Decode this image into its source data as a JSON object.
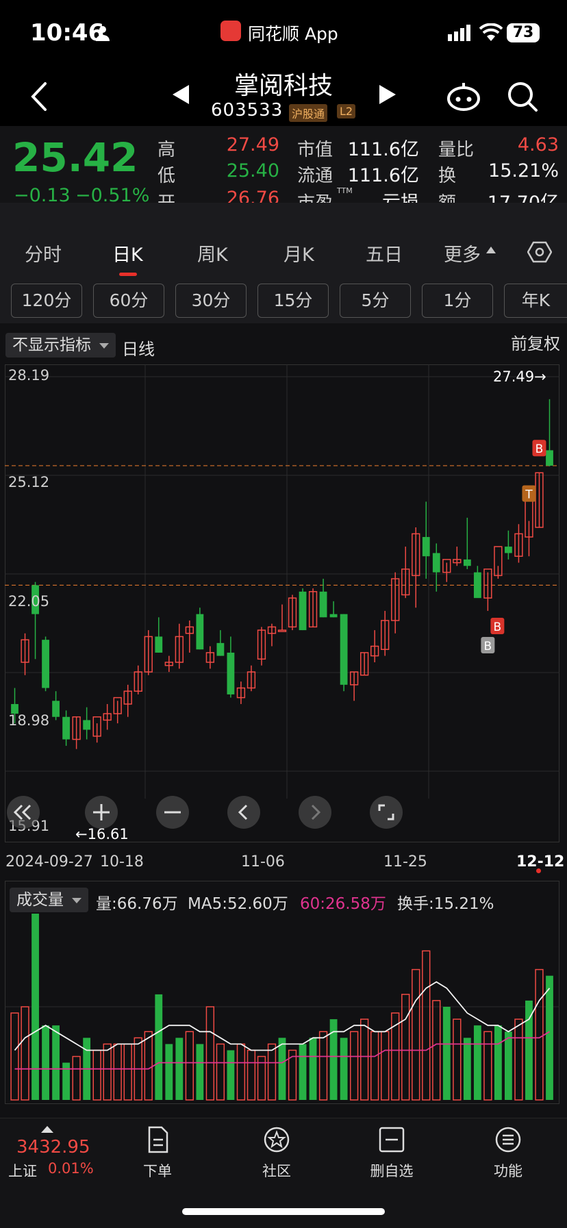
{
  "status_bar": {
    "time": "10:46",
    "app_name": "同花顺 App",
    "battery": "73"
  },
  "header": {
    "stock_name": "掌阅科技",
    "stock_code": "603533",
    "tags": [
      "沪股通",
      "L2"
    ]
  },
  "quote": {
    "price": "25.42",
    "change": "−0.13",
    "change_pct": "−0.51%",
    "high_label": "高",
    "high": "27.49",
    "low_label": "低",
    "low": "25.40",
    "open_label": "开",
    "open": "26.76",
    "mktcap_label": "市值",
    "mktcap": "111.6亿",
    "float_label": "流通",
    "float": "111.6亿",
    "pe_label": "市盈",
    "pe_sup": "TTM",
    "pe": "亏损",
    "volratio_label": "量比",
    "volratio": "4.63",
    "turnover_label": "换",
    "turnover": "15.21%",
    "amount_label": "额",
    "amount": "17.70亿"
  },
  "tabs": [
    "分时",
    "日K",
    "周K",
    "月K",
    "五日",
    "更多"
  ],
  "active_tab": "日K",
  "periods": [
    "120分",
    "60分",
    "30分",
    "15分",
    "5分",
    "1分",
    "年K"
  ],
  "chart_controls": {
    "indicator_select": "不显示指标",
    "line_type": "日线",
    "adjust": "前复权"
  },
  "chart_data": {
    "type": "candlestick",
    "y_axis_labels": [
      "28.19",
      "25.12",
      "22.05",
      "18.98",
      "15.91"
    ],
    "ylim": [
      15.91,
      28.19
    ],
    "x_labels": [
      "2024-09-27",
      "10-18",
      "11-06",
      "11-25",
      "12-12"
    ],
    "max_marker": "27.49→",
    "min_marker": "←16.61",
    "ref_lines": [
      25.42,
      21.7
    ],
    "trade_marks": [
      {
        "label": "B",
        "color": "#9a9a9a"
      },
      {
        "label": "B",
        "color": "#d9342b"
      },
      {
        "label": "T",
        "color": "#b5651d"
      },
      {
        "label": "B",
        "color": "#d9342b"
      }
    ],
    "candles": [
      {
        "o": 18.0,
        "h": 18.5,
        "l": 17.4,
        "c": 17.7
      },
      {
        "o": 19.3,
        "h": 20.2,
        "l": 18.9,
        "c": 20.0
      },
      {
        "o": 21.7,
        "h": 21.8,
        "l": 19.4,
        "c": 20.8
      },
      {
        "o": 20.0,
        "h": 20.1,
        "l": 18.4,
        "c": 18.5
      },
      {
        "o": 18.1,
        "h": 18.4,
        "l": 17.5,
        "c": 17.6
      },
      {
        "o": 17.6,
        "h": 17.8,
        "l": 16.7,
        "c": 16.9
      },
      {
        "o": 16.9,
        "h": 17.6,
        "l": 16.6,
        "c": 17.6
      },
      {
        "o": 17.5,
        "h": 17.9,
        "l": 16.9,
        "c": 17.2
      },
      {
        "o": 17.0,
        "h": 17.4,
        "l": 16.8,
        "c": 17.6
      },
      {
        "o": 17.5,
        "h": 18.0,
        "l": 17.2,
        "c": 17.7
      },
      {
        "o": 17.7,
        "h": 18.1,
        "l": 17.4,
        "c": 18.2
      },
      {
        "o": 18.0,
        "h": 18.6,
        "l": 17.6,
        "c": 18.4
      },
      {
        "o": 18.4,
        "h": 19.2,
        "l": 18.3,
        "c": 19.0
      },
      {
        "o": 19.0,
        "h": 20.3,
        "l": 18.9,
        "c": 20.1
      },
      {
        "o": 20.1,
        "h": 20.7,
        "l": 19.6,
        "c": 19.6
      },
      {
        "o": 19.2,
        "h": 19.5,
        "l": 19.0,
        "c": 19.3
      },
      {
        "o": 19.3,
        "h": 20.5,
        "l": 19.1,
        "c": 20.1
      },
      {
        "o": 20.2,
        "h": 20.6,
        "l": 19.6,
        "c": 20.4
      },
      {
        "o": 20.8,
        "h": 21.0,
        "l": 19.7,
        "c": 19.7
      },
      {
        "o": 19.3,
        "h": 19.8,
        "l": 19.1,
        "c": 19.6
      },
      {
        "o": 19.9,
        "h": 20.3,
        "l": 19.5,
        "c": 19.5
      },
      {
        "o": 19.6,
        "h": 20.1,
        "l": 18.2,
        "c": 18.3
      },
      {
        "o": 18.2,
        "h": 18.7,
        "l": 18.0,
        "c": 18.5
      },
      {
        "o": 18.5,
        "h": 19.2,
        "l": 18.4,
        "c": 19.0
      },
      {
        "o": 19.4,
        "h": 20.4,
        "l": 19.2,
        "c": 20.3
      },
      {
        "o": 20.2,
        "h": 20.5,
        "l": 19.8,
        "c": 20.4
      },
      {
        "o": 20.3,
        "h": 21.1,
        "l": 20.3,
        "c": 20.3
      },
      {
        "o": 20.4,
        "h": 21.4,
        "l": 20.3,
        "c": 21.3
      },
      {
        "o": 21.5,
        "h": 21.6,
        "l": 20.3,
        "c": 20.3
      },
      {
        "o": 20.4,
        "h": 21.6,
        "l": 20.4,
        "c": 21.5
      },
      {
        "o": 21.5,
        "h": 21.9,
        "l": 20.7,
        "c": 20.7
      },
      {
        "o": 20.8,
        "h": 21.2,
        "l": 20.7,
        "c": 20.7
      },
      {
        "o": 20.8,
        "h": 20.8,
        "l": 18.4,
        "c": 18.6
      },
      {
        "o": 18.6,
        "h": 19.0,
        "l": 18.1,
        "c": 19.0
      },
      {
        "o": 18.9,
        "h": 19.6,
        "l": 18.9,
        "c": 19.6
      },
      {
        "o": 19.5,
        "h": 20.3,
        "l": 19.3,
        "c": 19.8
      },
      {
        "o": 19.7,
        "h": 20.9,
        "l": 19.5,
        "c": 20.6
      },
      {
        "o": 20.6,
        "h": 22.1,
        "l": 20.2,
        "c": 21.9
      },
      {
        "o": 21.4,
        "h": 22.9,
        "l": 21.3,
        "c": 22.2
      },
      {
        "o": 22.0,
        "h": 23.5,
        "l": 21.0,
        "c": 23.3
      },
      {
        "o": 23.2,
        "h": 24.3,
        "l": 21.9,
        "c": 22.6
      },
      {
        "o": 22.7,
        "h": 23.0,
        "l": 21.5,
        "c": 22.1
      },
      {
        "o": 22.1,
        "h": 22.4,
        "l": 21.8,
        "c": 22.5
      },
      {
        "o": 22.4,
        "h": 22.9,
        "l": 22.3,
        "c": 22.5
      },
      {
        "o": 22.5,
        "h": 23.8,
        "l": 22.2,
        "c": 22.3
      },
      {
        "o": 22.1,
        "h": 22.3,
        "l": 21.6,
        "c": 21.3
      },
      {
        "o": 21.3,
        "h": 22.1,
        "l": 20.9,
        "c": 22.2
      },
      {
        "o": 22.0,
        "h": 22.3,
        "l": 21.9,
        "c": 22.9
      },
      {
        "o": 22.9,
        "h": 23.4,
        "l": 22.5,
        "c": 22.7
      },
      {
        "o": 22.6,
        "h": 23.6,
        "l": 22.4,
        "c": 23.3
      },
      {
        "o": 23.2,
        "h": 23.7,
        "l": 22.6,
        "c": 24.5
      },
      {
        "o": 23.5,
        "h": 25.2,
        "l": 23.5,
        "c": 25.2
      },
      {
        "o": 25.9,
        "h": 27.49,
        "l": 25.4,
        "c": 25.42
      }
    ]
  },
  "volume": {
    "select": "成交量",
    "vol": "量:66.76万",
    "ma5": "MA5:52.60万",
    "ma60": "60:26.58万",
    "turnover": "换手:15.21%",
    "bars": [
      14,
      15,
      30,
      12,
      12,
      6,
      7,
      10,
      8,
      9,
      9,
      9,
      10,
      11,
      17,
      9,
      10,
      11,
      9,
      15,
      9,
      8,
      9,
      8,
      7,
      9,
      10,
      8,
      9,
      10,
      11,
      13,
      10,
      11,
      13,
      11,
      11,
      14,
      17,
      21,
      24,
      16,
      15,
      13,
      10,
      12,
      11,
      12,
      11,
      13,
      16,
      21,
      20
    ],
    "colors": [
      "r",
      "r",
      "g",
      "g",
      "g",
      "g",
      "r",
      "g",
      "r",
      "r",
      "r",
      "r",
      "r",
      "r",
      "g",
      "g",
      "g",
      "r",
      "g",
      "r",
      "r",
      "g",
      "r",
      "r",
      "r",
      "r",
      "g",
      "r",
      "g",
      "g",
      "r",
      "g",
      "g",
      "r",
      "r",
      "r",
      "r",
      "r",
      "r",
      "r",
      "r",
      "r",
      "g",
      "r",
      "g",
      "g",
      "r",
      "g",
      "g",
      "r",
      "g",
      "r",
      "g"
    ],
    "ma_white": [
      8,
      10,
      11,
      12,
      11,
      10,
      9,
      8,
      8,
      8,
      9,
      9,
      9,
      10,
      11,
      12,
      12,
      12,
      11,
      11,
      10,
      9,
      9,
      8,
      8,
      8,
      9,
      9,
      9,
      10,
      10,
      11,
      11,
      12,
      12,
      11,
      11,
      12,
      13,
      16,
      18,
      19,
      18,
      16,
      14,
      13,
      12,
      12,
      11,
      12,
      13,
      16,
      18
    ],
    "ma_pink": [
      5,
      5,
      5,
      5,
      5,
      5,
      5,
      5,
      5,
      5,
      5,
      5,
      5,
      5,
      6,
      6,
      6,
      6,
      6,
      6,
      6,
      6,
      6,
      6,
      6,
      6,
      6,
      7,
      7,
      7,
      7,
      7,
      7,
      7,
      7,
      7,
      8,
      8,
      8,
      8,
      8,
      9,
      9,
      9,
      9,
      9,
      9,
      9,
      10,
      10,
      10,
      10,
      11
    ]
  },
  "bottom_bar": {
    "index_value": "3432.95",
    "index_name": "上证",
    "index_pct": "0.01%",
    "items": [
      "下单",
      "社区",
      "删自选",
      "功能"
    ]
  }
}
